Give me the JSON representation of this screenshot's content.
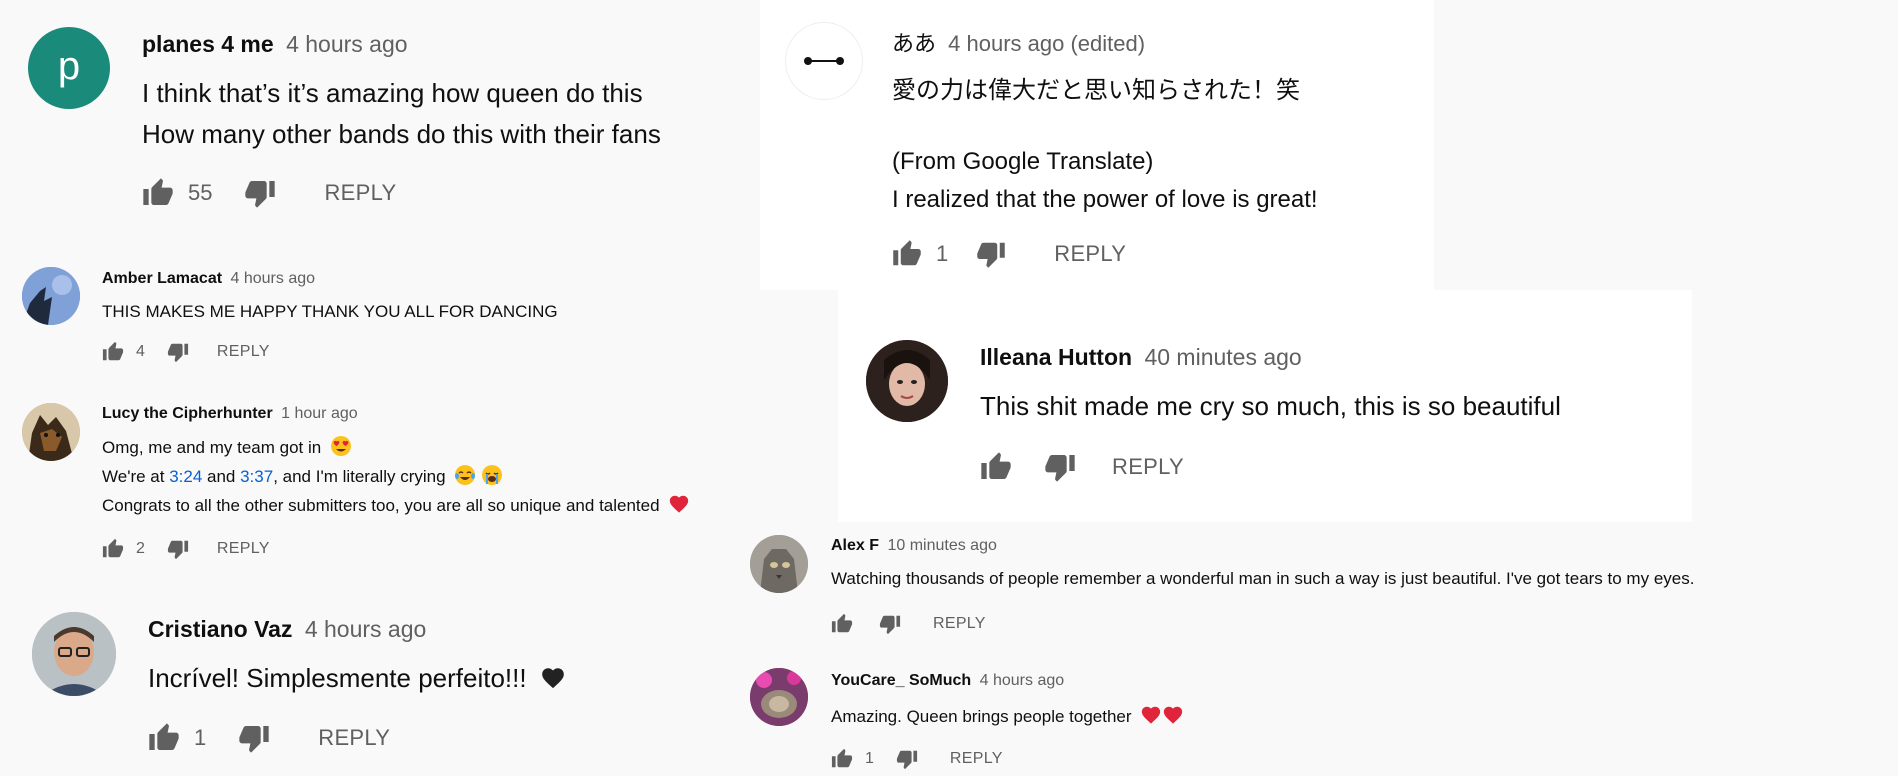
{
  "comments": [
    {
      "id": "c1",
      "avatar_letter": "p",
      "avatar_color": "#1a8a7a",
      "author": "planes 4 me",
      "time": "4 hours ago",
      "lines": [
        "I think that’s it’s amazing how queen do this",
        "How many other bands do this with their fans"
      ],
      "likes": "55",
      "reply_label": "REPLY"
    },
    {
      "id": "c2",
      "author": "Amber Lamacat",
      "time": "4 hours ago",
      "lines": [
        "THIS MAKES ME HAPPY THANK YOU ALL FOR DANCING"
      ],
      "likes": "4",
      "reply_label": "REPLY"
    },
    {
      "id": "c3",
      "author": "Lucy the Cipherhunter",
      "time": "1 hour ago",
      "line1": "Omg, me and my team got in",
      "line2_a": "We're at ",
      "link1": "3:24",
      "line2_b": " and ",
      "link2": "3:37",
      "line2_c": ", and I'm literally crying",
      "line3": "Congrats to all the other submitters too, you are all so unique and talented",
      "likes": "2",
      "reply_label": "REPLY"
    },
    {
      "id": "c4",
      "author": "Cristiano Vaz",
      "time": "4 hours ago",
      "lines": [
        "Incrível! Simplesmente perfeito!!!"
      ],
      "likes": "1",
      "reply_label": "REPLY"
    },
    {
      "id": "c5",
      "author": "ああ",
      "time": "4 hours ago (edited)",
      "lines": [
        "愛の力は偉大だと思い知らされた！笑",
        "(From Google Translate)",
        "I realized that the power of love is great!"
      ],
      "likes": "1",
      "reply_label": "REPLY"
    },
    {
      "id": "c6",
      "author": "Illeana Hutton",
      "time": "40 minutes ago",
      "lines": [
        "This shit made me cry so much, this is so beautiful"
      ],
      "likes": "",
      "reply_label": "REPLY"
    },
    {
      "id": "c7",
      "author": "Alex F",
      "time": "10 minutes ago",
      "lines": [
        "Watching thousands of people remember a wonderful man in such a way is just beautiful. I've got tears to my eyes."
      ],
      "likes": "",
      "reply_label": "REPLY"
    },
    {
      "id": "c8",
      "author": "YouCare_ SoMuch",
      "time": "4 hours ago",
      "lines": [
        "Amazing. Queen brings people together"
      ],
      "likes": "1",
      "reply_label": "REPLY"
    }
  ],
  "colors": {
    "text": "#0f0f0f",
    "meta": "#606060",
    "link": "#065fd4",
    "heart": "#e0243a",
    "avatar_p": "#1a8a7a"
  },
  "icons": [
    "thumbs-up-icon",
    "thumbs-down-icon",
    "heart-icon",
    "heart-eyes-emoji",
    "tears-of-joy-emoji",
    "crying-emoji"
  ]
}
